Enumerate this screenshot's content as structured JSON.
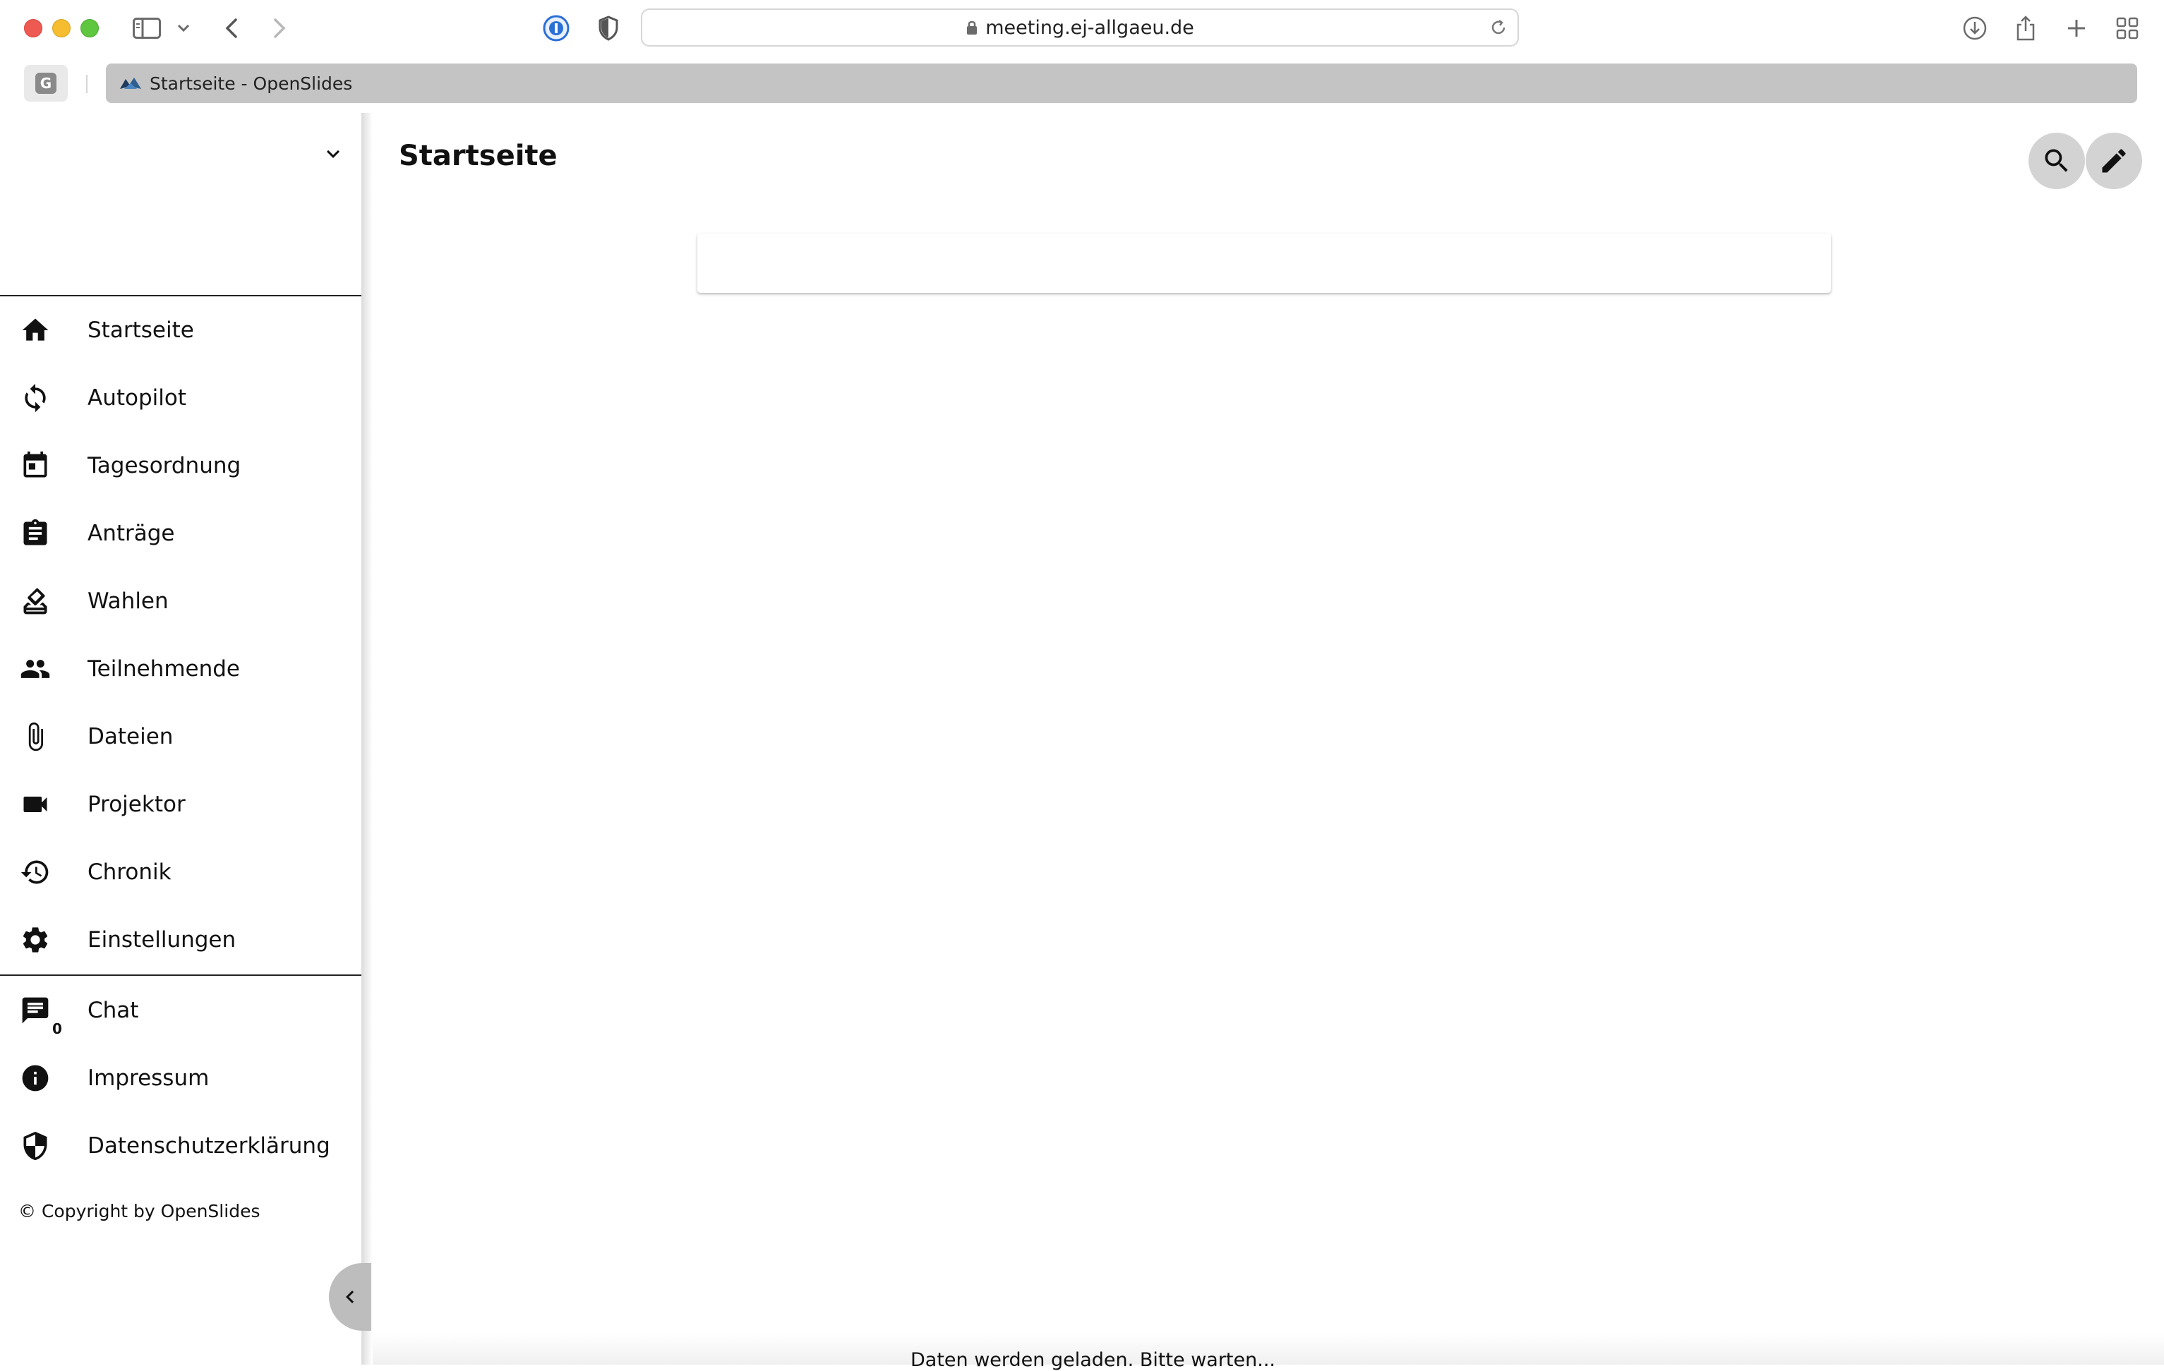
{
  "browser": {
    "url": "meeting.ej-allgaeu.de",
    "pinned_tab_letter": "G",
    "active_tab_title": "Startseite - OpenSlides"
  },
  "sidebar": {
    "items": [
      {
        "label": "Startseite",
        "icon": "home-icon"
      },
      {
        "label": "Autopilot",
        "icon": "sync-icon"
      },
      {
        "label": "Tagesordnung",
        "icon": "calendar-icon"
      },
      {
        "label": "Anträge",
        "icon": "clipboard-icon"
      },
      {
        "label": "Wahlen",
        "icon": "ballot-icon"
      },
      {
        "label": "Teilnehmende",
        "icon": "people-icon"
      },
      {
        "label": "Dateien",
        "icon": "paperclip-icon"
      },
      {
        "label": "Projektor",
        "icon": "videocam-icon"
      },
      {
        "label": "Chronik",
        "icon": "history-icon"
      },
      {
        "label": "Einstellungen",
        "icon": "gear-icon"
      }
    ],
    "secondary_items": [
      {
        "label": "Chat",
        "icon": "chat-icon",
        "badge": "0"
      },
      {
        "label": "Impressum",
        "icon": "info-icon"
      },
      {
        "label": "Datenschutzerklärung",
        "icon": "shield-icon"
      }
    ],
    "copyright": "© Copyright by OpenSlides"
  },
  "main": {
    "title": "Startseite",
    "loading_text": "Daten werden geladen. Bitte warten..."
  }
}
